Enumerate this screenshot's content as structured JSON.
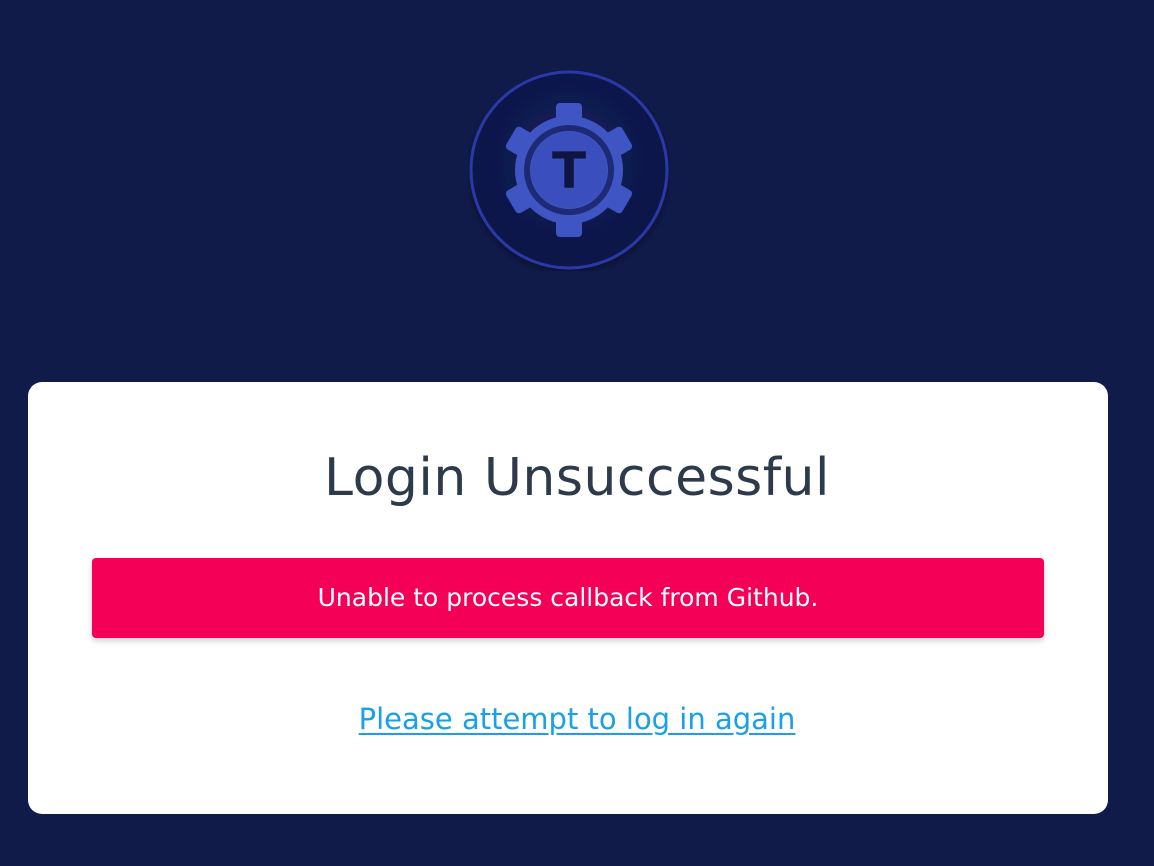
{
  "logo": {
    "letter": "T",
    "colors": {
      "ring": "#2a38a8",
      "inner": "#0f1a4f",
      "gear": "#3f55c4",
      "letter": "#0d1540"
    }
  },
  "card": {
    "title": "Login Unsuccessful",
    "error_message": "Unable to process callback from Github.",
    "retry_link_text": "Please attempt to log in again"
  },
  "colors": {
    "background": "#111b4a",
    "card": "#ffffff",
    "title_text": "#2c3a4b",
    "error_banner": "#f50057",
    "link": "#1aa0e8"
  }
}
